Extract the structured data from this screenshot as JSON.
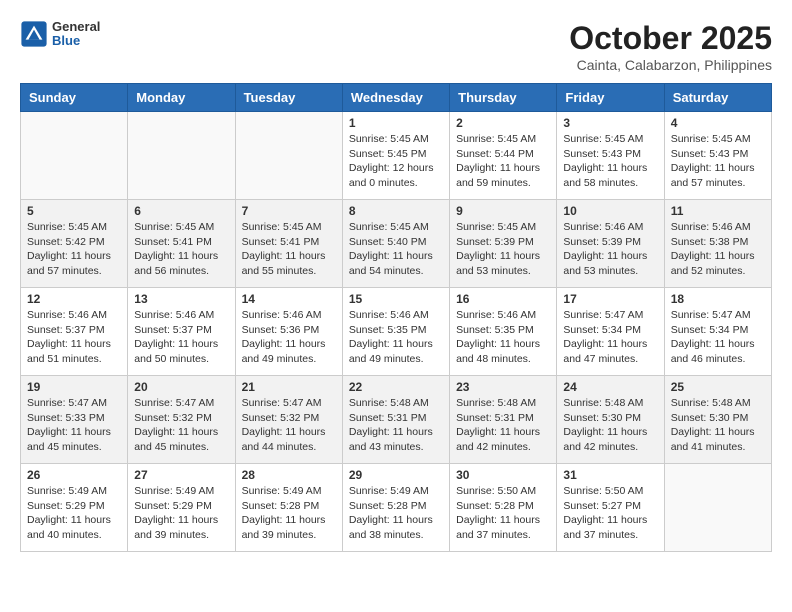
{
  "header": {
    "logo_general": "General",
    "logo_blue": "Blue",
    "month_title": "October 2025",
    "subtitle": "Cainta, Calabarzon, Philippines"
  },
  "days_of_week": [
    "Sunday",
    "Monday",
    "Tuesday",
    "Wednesday",
    "Thursday",
    "Friday",
    "Saturday"
  ],
  "weeks": [
    [
      {
        "day": "",
        "sunrise": "",
        "sunset": "",
        "daylight": "",
        "empty": true
      },
      {
        "day": "",
        "sunrise": "",
        "sunset": "",
        "daylight": "",
        "empty": true
      },
      {
        "day": "",
        "sunrise": "",
        "sunset": "",
        "daylight": "",
        "empty": true
      },
      {
        "day": "1",
        "sunrise": "Sunrise: 5:45 AM",
        "sunset": "Sunset: 5:45 PM",
        "daylight": "Daylight: 12 hours and 0 minutes."
      },
      {
        "day": "2",
        "sunrise": "Sunrise: 5:45 AM",
        "sunset": "Sunset: 5:44 PM",
        "daylight": "Daylight: 11 hours and 59 minutes."
      },
      {
        "day": "3",
        "sunrise": "Sunrise: 5:45 AM",
        "sunset": "Sunset: 5:43 PM",
        "daylight": "Daylight: 11 hours and 58 minutes."
      },
      {
        "day": "4",
        "sunrise": "Sunrise: 5:45 AM",
        "sunset": "Sunset: 5:43 PM",
        "daylight": "Daylight: 11 hours and 57 minutes."
      }
    ],
    [
      {
        "day": "5",
        "sunrise": "Sunrise: 5:45 AM",
        "sunset": "Sunset: 5:42 PM",
        "daylight": "Daylight: 11 hours and 57 minutes."
      },
      {
        "day": "6",
        "sunrise": "Sunrise: 5:45 AM",
        "sunset": "Sunset: 5:41 PM",
        "daylight": "Daylight: 11 hours and 56 minutes."
      },
      {
        "day": "7",
        "sunrise": "Sunrise: 5:45 AM",
        "sunset": "Sunset: 5:41 PM",
        "daylight": "Daylight: 11 hours and 55 minutes."
      },
      {
        "day": "8",
        "sunrise": "Sunrise: 5:45 AM",
        "sunset": "Sunset: 5:40 PM",
        "daylight": "Daylight: 11 hours and 54 minutes."
      },
      {
        "day": "9",
        "sunrise": "Sunrise: 5:45 AM",
        "sunset": "Sunset: 5:39 PM",
        "daylight": "Daylight: 11 hours and 53 minutes."
      },
      {
        "day": "10",
        "sunrise": "Sunrise: 5:46 AM",
        "sunset": "Sunset: 5:39 PM",
        "daylight": "Daylight: 11 hours and 53 minutes."
      },
      {
        "day": "11",
        "sunrise": "Sunrise: 5:46 AM",
        "sunset": "Sunset: 5:38 PM",
        "daylight": "Daylight: 11 hours and 52 minutes."
      }
    ],
    [
      {
        "day": "12",
        "sunrise": "Sunrise: 5:46 AM",
        "sunset": "Sunset: 5:37 PM",
        "daylight": "Daylight: 11 hours and 51 minutes."
      },
      {
        "day": "13",
        "sunrise": "Sunrise: 5:46 AM",
        "sunset": "Sunset: 5:37 PM",
        "daylight": "Daylight: 11 hours and 50 minutes."
      },
      {
        "day": "14",
        "sunrise": "Sunrise: 5:46 AM",
        "sunset": "Sunset: 5:36 PM",
        "daylight": "Daylight: 11 hours and 49 minutes."
      },
      {
        "day": "15",
        "sunrise": "Sunrise: 5:46 AM",
        "sunset": "Sunset: 5:35 PM",
        "daylight": "Daylight: 11 hours and 49 minutes."
      },
      {
        "day": "16",
        "sunrise": "Sunrise: 5:46 AM",
        "sunset": "Sunset: 5:35 PM",
        "daylight": "Daylight: 11 hours and 48 minutes."
      },
      {
        "day": "17",
        "sunrise": "Sunrise: 5:47 AM",
        "sunset": "Sunset: 5:34 PM",
        "daylight": "Daylight: 11 hours and 47 minutes."
      },
      {
        "day": "18",
        "sunrise": "Sunrise: 5:47 AM",
        "sunset": "Sunset: 5:34 PM",
        "daylight": "Daylight: 11 hours and 46 minutes."
      }
    ],
    [
      {
        "day": "19",
        "sunrise": "Sunrise: 5:47 AM",
        "sunset": "Sunset: 5:33 PM",
        "daylight": "Daylight: 11 hours and 45 minutes."
      },
      {
        "day": "20",
        "sunrise": "Sunrise: 5:47 AM",
        "sunset": "Sunset: 5:32 PM",
        "daylight": "Daylight: 11 hours and 45 minutes."
      },
      {
        "day": "21",
        "sunrise": "Sunrise: 5:47 AM",
        "sunset": "Sunset: 5:32 PM",
        "daylight": "Daylight: 11 hours and 44 minutes."
      },
      {
        "day": "22",
        "sunrise": "Sunrise: 5:48 AM",
        "sunset": "Sunset: 5:31 PM",
        "daylight": "Daylight: 11 hours and 43 minutes."
      },
      {
        "day": "23",
        "sunrise": "Sunrise: 5:48 AM",
        "sunset": "Sunset: 5:31 PM",
        "daylight": "Daylight: 11 hours and 42 minutes."
      },
      {
        "day": "24",
        "sunrise": "Sunrise: 5:48 AM",
        "sunset": "Sunset: 5:30 PM",
        "daylight": "Daylight: 11 hours and 42 minutes."
      },
      {
        "day": "25",
        "sunrise": "Sunrise: 5:48 AM",
        "sunset": "Sunset: 5:30 PM",
        "daylight": "Daylight: 11 hours and 41 minutes."
      }
    ],
    [
      {
        "day": "26",
        "sunrise": "Sunrise: 5:49 AM",
        "sunset": "Sunset: 5:29 PM",
        "daylight": "Daylight: 11 hours and 40 minutes."
      },
      {
        "day": "27",
        "sunrise": "Sunrise: 5:49 AM",
        "sunset": "Sunset: 5:29 PM",
        "daylight": "Daylight: 11 hours and 39 minutes."
      },
      {
        "day": "28",
        "sunrise": "Sunrise: 5:49 AM",
        "sunset": "Sunset: 5:28 PM",
        "daylight": "Daylight: 11 hours and 39 minutes."
      },
      {
        "day": "29",
        "sunrise": "Sunrise: 5:49 AM",
        "sunset": "Sunset: 5:28 PM",
        "daylight": "Daylight: 11 hours and 38 minutes."
      },
      {
        "day": "30",
        "sunrise": "Sunrise: 5:50 AM",
        "sunset": "Sunset: 5:28 PM",
        "daylight": "Daylight: 11 hours and 37 minutes."
      },
      {
        "day": "31",
        "sunrise": "Sunrise: 5:50 AM",
        "sunset": "Sunset: 5:27 PM",
        "daylight": "Daylight: 11 hours and 37 minutes."
      },
      {
        "day": "",
        "sunrise": "",
        "sunset": "",
        "daylight": "",
        "empty": true
      }
    ]
  ]
}
